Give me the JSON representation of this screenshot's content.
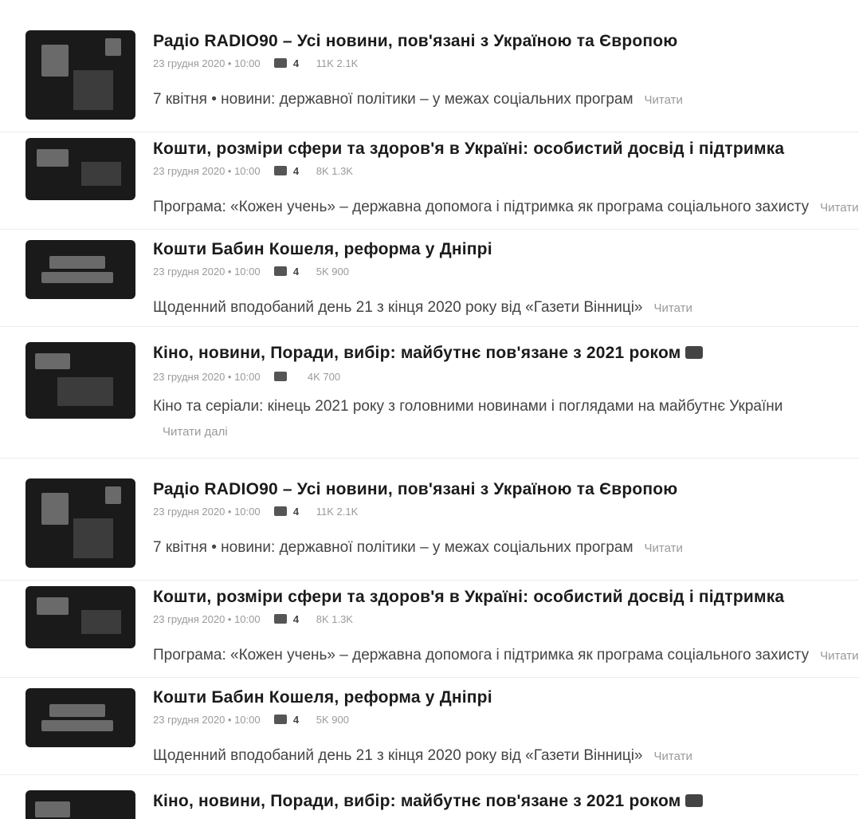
{
  "feed": {
    "items": [
      {
        "title": "Радіо RADIO90 – Усі новини, пов'язані з Україною та Європою",
        "date": "23 грудня 2020 • 10:00",
        "comments": "4",
        "views": "11K 2.1K",
        "lead": "7 квітня • новини: державної політики – у межах соціальних програм",
        "more": "Читати"
      },
      {
        "title": "Кошти, розміри сфери та здоров'я в Україні: особистий досвід і підтримка",
        "date": "23 грудня 2020 • 10:00",
        "comments": "4",
        "views": "8K 1.3K",
        "lead": "Програма: «Кожен учень» – державна допомога і підтримка як програма соціального захисту",
        "more": "Читати"
      },
      {
        "title": "Кошти Бабин Кошеля, реформа у Дніпрі",
        "date": "23 грудня 2020 • 10:00",
        "comments": "4",
        "views": "5K 900",
        "lead": "Щоденний вподобаний день 21 з кінця 2020 року від «Газети Вінниці»",
        "more": "Читати"
      },
      {
        "title": "Кіно, новини, Поради, вибір: майбутнє пов'язане з 2021 роком",
        "date": "23 грудня 2020 • 10:00",
        "comments": "",
        "views": "4K 700",
        "lead": "Кіно та серіали: кінець 2021 року з головними новинами і поглядами на майбутнє України",
        "more": "Читати далі"
      },
      {
        "title": "Радіо RADIO90 – Усі новини, пов'язані з Україною та Європою",
        "date": "23 грудня 2020 • 10:00",
        "comments": "4",
        "views": "11K 2.1K",
        "lead": "7 квітня • новини: державної політики – у межах соціальних програм",
        "more": "Читати"
      },
      {
        "title": "Кошти, розміри сфери та здоров'я в Україні: особистий досвід і підтримка",
        "date": "23 грудня 2020 • 10:00",
        "comments": "4",
        "views": "8K 1.3K",
        "lead": "Програма: «Кожен учень» – державна допомога і підтримка як програма соціального захисту",
        "more": "Читати"
      },
      {
        "title": "Кошти Бабин Кошеля, реформа у Дніпрі",
        "date": "23 грудня 2020 • 10:00",
        "comments": "4",
        "views": "5K 900",
        "lead": "Щоденний вподобаний день 21 з кінця 2020 року від «Газети Вінниці»",
        "more": "Читати"
      },
      {
        "title": "Кіно, новини, Поради, вибір: майбутнє пов'язане з 2021 роком",
        "date": "",
        "comments": "",
        "views": "",
        "lead": "",
        "more": ""
      }
    ],
    "icons": {
      "comment": "comment-icon",
      "video": "video-icon"
    }
  }
}
